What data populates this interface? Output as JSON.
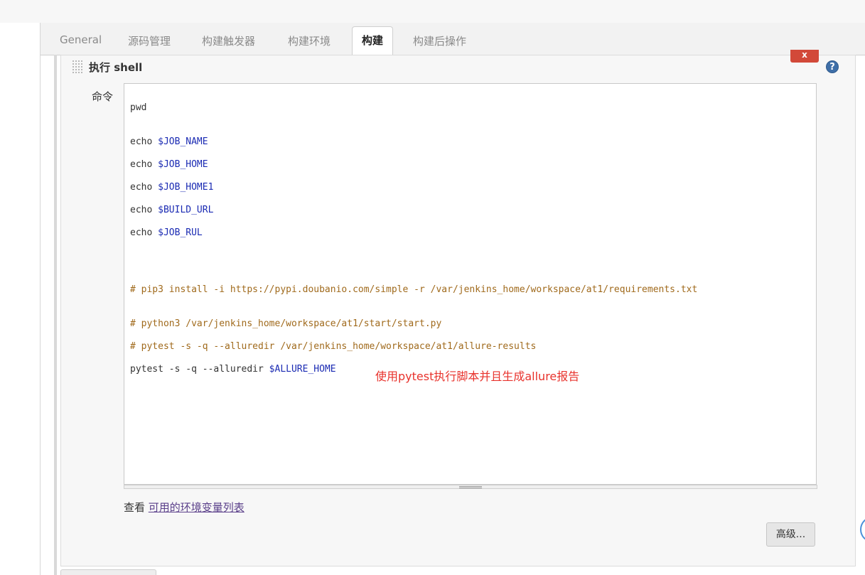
{
  "tabs": [
    {
      "label": "General",
      "active": false
    },
    {
      "label": "源码管理",
      "active": false
    },
    {
      "label": "构建触发器",
      "active": false
    },
    {
      "label": "构建环境",
      "active": false
    },
    {
      "label": "构建",
      "active": true
    },
    {
      "label": "构建后操作",
      "active": false
    }
  ],
  "build_step": {
    "title": "执行 shell",
    "delete_label": "x",
    "help_label": "?",
    "command_label": "命令",
    "code": {
      "l1": "pwd",
      "l2_cmd": "echo ",
      "l2_var": "$JOB_NAME",
      "l3_cmd": "echo ",
      "l3_var": "$JOB_HOME",
      "l4_cmd": "echo ",
      "l4_var": "$JOB_HOME1",
      "l5_cmd": "echo ",
      "l5_var": "$BUILD_URL",
      "l6_cmd": "echo ",
      "l6_var": "$JOB_RUL",
      "c1": "# pip3 install -i https://pypi.doubanio.com/simple -r /var/jenkins_home/workspace/at1/requirements.txt",
      "c2": "# python3 /var/jenkins_home/workspace/at1/start/start.py",
      "c3": "# pytest -s -q --alluredir /var/jenkins_home/workspace/at1/allure-results",
      "last_cmd": "pytest -s -q --alluredir ",
      "last_var": "$ALLURE_HOME"
    },
    "annotation": "使用pytest执行脚本并且生成allure报告",
    "env_prefix": "查看 ",
    "env_link": "可用的环境变量列表",
    "advanced_label": "高级..."
  },
  "colors": {
    "variable": "#1b2bb3",
    "comment": "#a06a1c",
    "annotation": "#e8322c",
    "delete": "#d24939",
    "help": "#3f6fa8"
  }
}
